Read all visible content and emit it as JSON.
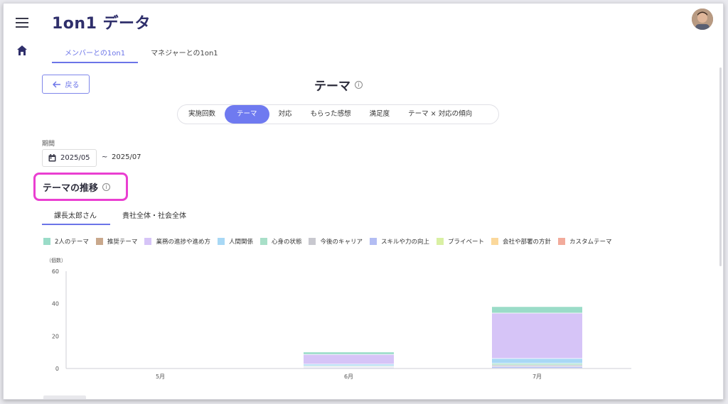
{
  "app": {
    "title": "1on1 データ"
  },
  "top_tabs": [
    {
      "label": "メンバーとの1on1",
      "active": true
    },
    {
      "label": "マネジャーとの1on1",
      "active": false
    }
  ],
  "back_label": "戻る",
  "page_title": "テーマ",
  "segments": [
    {
      "label": "実施回数",
      "active": false
    },
    {
      "label": "テーマ",
      "active": true
    },
    {
      "label": "対応",
      "active": false
    },
    {
      "label": "もらった感想",
      "active": false
    },
    {
      "label": "満足度",
      "active": false
    },
    {
      "label": "テーマ × 対応の傾向",
      "active": false
    }
  ],
  "period": {
    "label": "期間",
    "start": "2025/05",
    "separator": "~",
    "end": "2025/07"
  },
  "section_title": "テーマの推移",
  "sub_tabs": [
    {
      "label": "課長太郎さん",
      "active": true
    },
    {
      "label": "貴社全体・社会全体",
      "active": false
    }
  ],
  "colors": {
    "accent": "#6f7af0",
    "highlight": "#ea3fd1"
  },
  "chart_data": {
    "type": "bar",
    "stacked": true,
    "ylabel": "（個数）",
    "ylim": [
      0,
      60
    ],
    "yticks": [
      0,
      20,
      40,
      60
    ],
    "categories": [
      "5月",
      "6月",
      "7月"
    ],
    "grid": false,
    "legend_position": "top",
    "series": [
      {
        "name": "カスタムテーマ",
        "color": "#f2ab9b",
        "values": [
          0,
          0,
          0
        ]
      },
      {
        "name": "会社や部署の方針",
        "color": "#fbd89b",
        "values": [
          0,
          0,
          0
        ]
      },
      {
        "name": "プライベート",
        "color": "#d9f0a3",
        "values": [
          0,
          0,
          0
        ]
      },
      {
        "name": "スキルや力の向上",
        "color": "#b3bdf3",
        "values": [
          0,
          0.5,
          1
        ]
      },
      {
        "name": "今後のキャリア",
        "color": "#c8c8cf",
        "values": [
          0,
          0.5,
          1
        ]
      },
      {
        "name": "心身の状態",
        "color": "#a8dfc8",
        "values": [
          0,
          0.5,
          1
        ]
      },
      {
        "name": "人間関係",
        "color": "#a8d8f5",
        "values": [
          0,
          1,
          3
        ]
      },
      {
        "name": "業務の進捗や進め方",
        "color": "#d6c4f7",
        "values": [
          0,
          6,
          28
        ]
      },
      {
        "name": "推奨テーマ",
        "color": "#c9a88c",
        "values": [
          0,
          0,
          0
        ]
      },
      {
        "name": "2人のテーマ",
        "color": "#9adcc8",
        "values": [
          0,
          1.5,
          4
        ]
      }
    ]
  }
}
